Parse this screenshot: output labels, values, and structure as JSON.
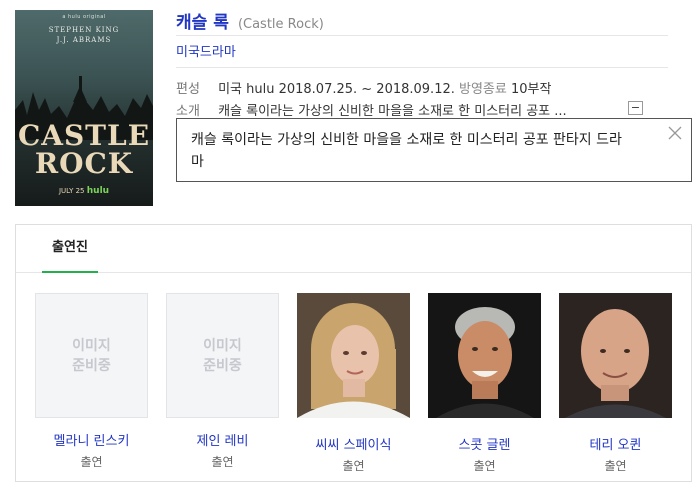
{
  "poster": {
    "credit_top": "a hulu original",
    "credit_line1": "STEPHEN KING",
    "credit_line2": "J.J. ABRAMS",
    "title_line1": "CASTLE",
    "title_line2": "ROCK",
    "release_date": "JULY 25",
    "release_network": "hulu"
  },
  "show": {
    "title": "캐슬 록",
    "title_original": "(Castle Rock)",
    "genre": "미국드라마",
    "schedule_label": "편성",
    "schedule_value": "미국 hulu 2018.07.25. ~ 2018.09.12.",
    "status": "방영종료",
    "episodes": "10부작",
    "intro_label": "소개",
    "intro_truncated": "캐슬 록이라는 가상의 신비한 마을을 소재로 한 미스터리 공포 ...",
    "collapse_label": "−",
    "intro_full_line1": "캐슬 록이라는 가상의 신비한 마을을 소재로 한 미스터리 공포 판타지 드라",
    "intro_full_line2": "마"
  },
  "cast_section": {
    "tab_label": "출연진",
    "placeholder_line1": "이미지",
    "placeholder_line2": "준비중",
    "members": [
      {
        "name": "멜라니 린스키",
        "role": "출연",
        "has_photo": false
      },
      {
        "name": "제인 레비",
        "role": "출연",
        "has_photo": false
      },
      {
        "name": "씨씨 스페이식",
        "role": "출연",
        "has_photo": true
      },
      {
        "name": "스콧 글렌",
        "role": "출연",
        "has_photo": true
      },
      {
        "name": "테리 오퀸",
        "role": "출연",
        "has_photo": true
      }
    ]
  },
  "colors": {
    "link": "#2236c4",
    "tab_underline": "#21b04b"
  }
}
